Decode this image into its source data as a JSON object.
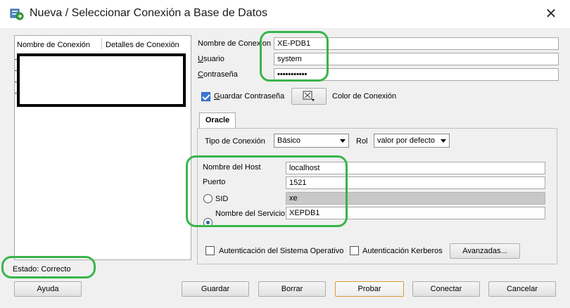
{
  "window": {
    "title": "Nueva / Seleccionar Conexión a Base de Datos",
    "close_glyph": "✕",
    "title_icon": "database-connection-icon"
  },
  "connection_list": {
    "columns": [
      "Nombre de Conexión",
      "Detalles de Conexión"
    ]
  },
  "form": {
    "connection_name_label": "Nombre de Conexion",
    "connection_name_value": "XE-PDB1",
    "user_label": "Usuario",
    "user_value": "system",
    "password_label": "Contraseña",
    "password_value": "•••••••••••",
    "save_password_label": "Guardar Contraseña",
    "save_password_checked": true,
    "color_label": "Color de Conexión"
  },
  "tabs": {
    "oracle": "Oracle"
  },
  "oracle": {
    "connection_type_label": "Tipo de Conexión",
    "connection_type_value": "Básico",
    "role_label": "Rol",
    "role_value": "valor por defecto",
    "host_label": "Nombre del Host",
    "host_value": "localhost",
    "port_label": "Puerto",
    "port_value": "1521",
    "sid_label": "SID",
    "sid_value": "xe",
    "service_label": "Nombre del Servicio",
    "service_value": "XEPDB1",
    "selected_option": "service"
  },
  "auth": {
    "os_auth_label": "Autenticación del Sistema Operativo",
    "kerberos_label": "Autenticación Kerberos",
    "advanced_label": "Avanzadas..."
  },
  "status": {
    "text": "Estado: Correcto"
  },
  "buttons": {
    "help": "Ayuda",
    "save": "Guardar",
    "clear": "Borrar",
    "test": "Probar",
    "connect": "Conectar",
    "cancel": "Cancelar"
  },
  "colors": {
    "highlight": "#39b54a",
    "checkbox_accent": "#3c78d8"
  }
}
